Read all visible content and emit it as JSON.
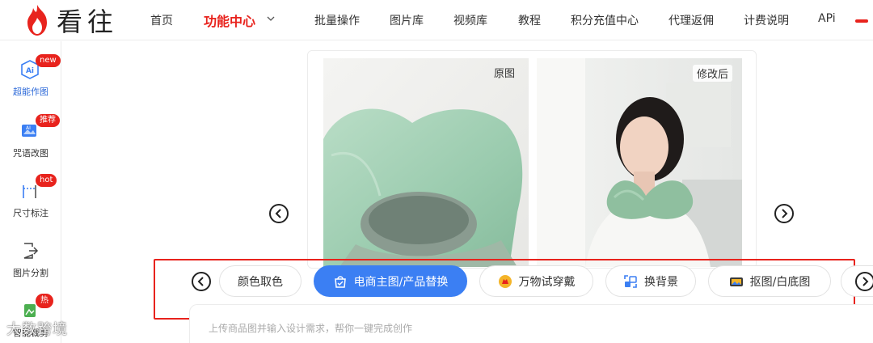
{
  "brand": {
    "name": "看往",
    "accent": "#e8231d",
    "blue": "#3b7ff3"
  },
  "nav": {
    "items": [
      {
        "label": "首页"
      },
      {
        "label": "功能中心"
      },
      {
        "label": "批量操作"
      },
      {
        "label": "图片库"
      },
      {
        "label": "视频库"
      },
      {
        "label": "教程"
      },
      {
        "label": "积分充值中心"
      },
      {
        "label": "代理返佣"
      },
      {
        "label": "计费说明"
      },
      {
        "label": "APi"
      }
    ]
  },
  "sidebar": {
    "items": [
      {
        "label": "超能作图",
        "badge": "new",
        "icon": "ai-image-icon"
      },
      {
        "label": "咒语改图",
        "badge": "推荐",
        "icon": "image-edit-icon"
      },
      {
        "label": "尺寸标注",
        "badge": "hot",
        "icon": "measure-icon"
      },
      {
        "label": "图片分割",
        "badge": "",
        "icon": "split-icon"
      },
      {
        "label": "智能裁剪",
        "badge": "热",
        "icon": "crop-icon"
      }
    ]
  },
  "compare": {
    "before_label": "原图",
    "after_label": "修改后"
  },
  "tabs": [
    {
      "label": "颜色取色",
      "icon": ""
    },
    {
      "label": "电商主图/产品替换",
      "icon": "shopping-bag-icon"
    },
    {
      "label": "万物试穿戴",
      "icon": "try-on-icon"
    },
    {
      "label": "换背景",
      "icon": "swap-background-icon"
    },
    {
      "label": "抠图/白底图",
      "icon": "cutout-icon"
    }
  ],
  "prompt": {
    "placeholder": "上传商品图并输入设计需求，帮你一键完成创作"
  },
  "watermark": "大数跨境"
}
